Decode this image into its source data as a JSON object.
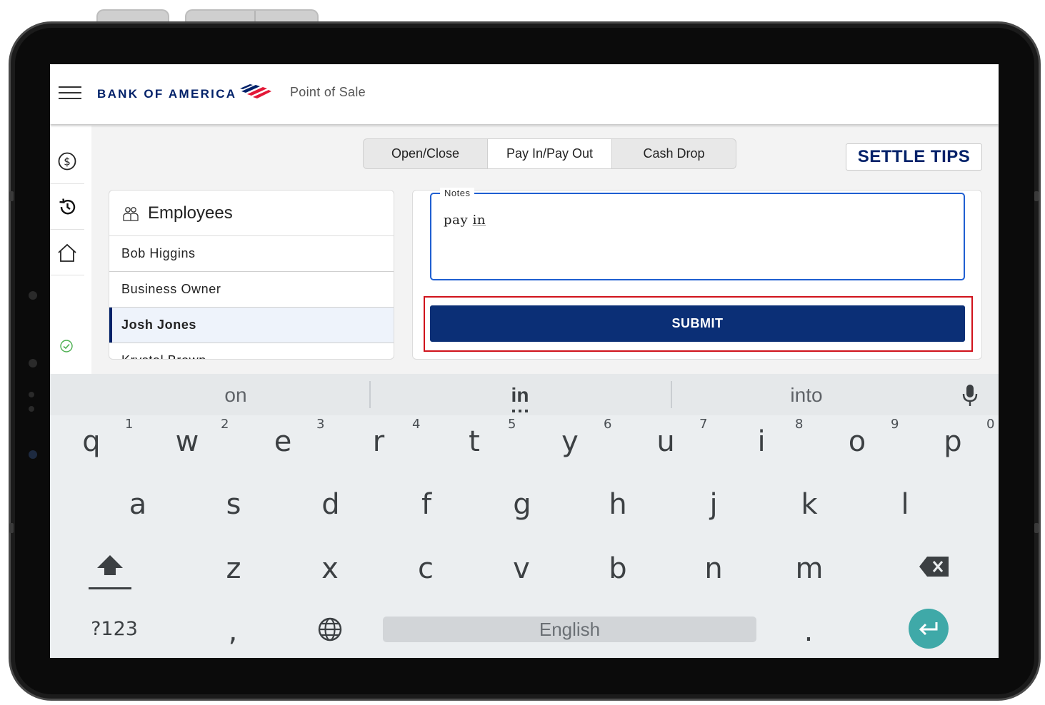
{
  "app": {
    "brand": "BANK OF AMERICA",
    "title": "Point of Sale"
  },
  "tabs": [
    "Open/Close",
    "Pay In/Pay Out",
    "Cash Drop"
  ],
  "active_tab": "Pay In/Pay Out",
  "settle_tips_label": "SETTLE TIPS",
  "employees": {
    "title": "Employees",
    "list": [
      "Bob Higgins",
      "Business Owner",
      "Josh Jones",
      "Krystal Brown"
    ],
    "selected": "Josh Jones"
  },
  "notes": {
    "label": "Notes",
    "value_word1": "pay",
    "value_word2": "in"
  },
  "submit_label": "SUBMIT",
  "keyboard": {
    "suggestions": [
      "on",
      "in",
      "into"
    ],
    "row1": [
      "q",
      "w",
      "e",
      "r",
      "t",
      "y",
      "u",
      "i",
      "o",
      "p"
    ],
    "row1_hints": [
      "1",
      "2",
      "3",
      "4",
      "5",
      "6",
      "7",
      "8",
      "9",
      "0"
    ],
    "row2": [
      "a",
      "s",
      "d",
      "f",
      "g",
      "h",
      "j",
      "k",
      "l"
    ],
    "row3": [
      "z",
      "x",
      "c",
      "v",
      "b",
      "n",
      "m"
    ],
    "symbols_label": "?123",
    "comma": ",",
    "period": ".",
    "space_label": "English"
  },
  "colors": {
    "brand_navy": "#012169",
    "submit_bg": "#0b2f76",
    "highlight_red": "#d0121b",
    "notes_border": "#1f5fd1",
    "enter_teal": "#3fa9a8",
    "check_green": "#4caf50"
  },
  "icons": [
    "menu-icon",
    "boa-flag-logo",
    "dollar-icon",
    "history-icon",
    "home-icon",
    "check-circle-icon",
    "employees-icon",
    "mic-icon",
    "shift-icon",
    "backspace-icon",
    "globe-icon",
    "enter-icon"
  ]
}
